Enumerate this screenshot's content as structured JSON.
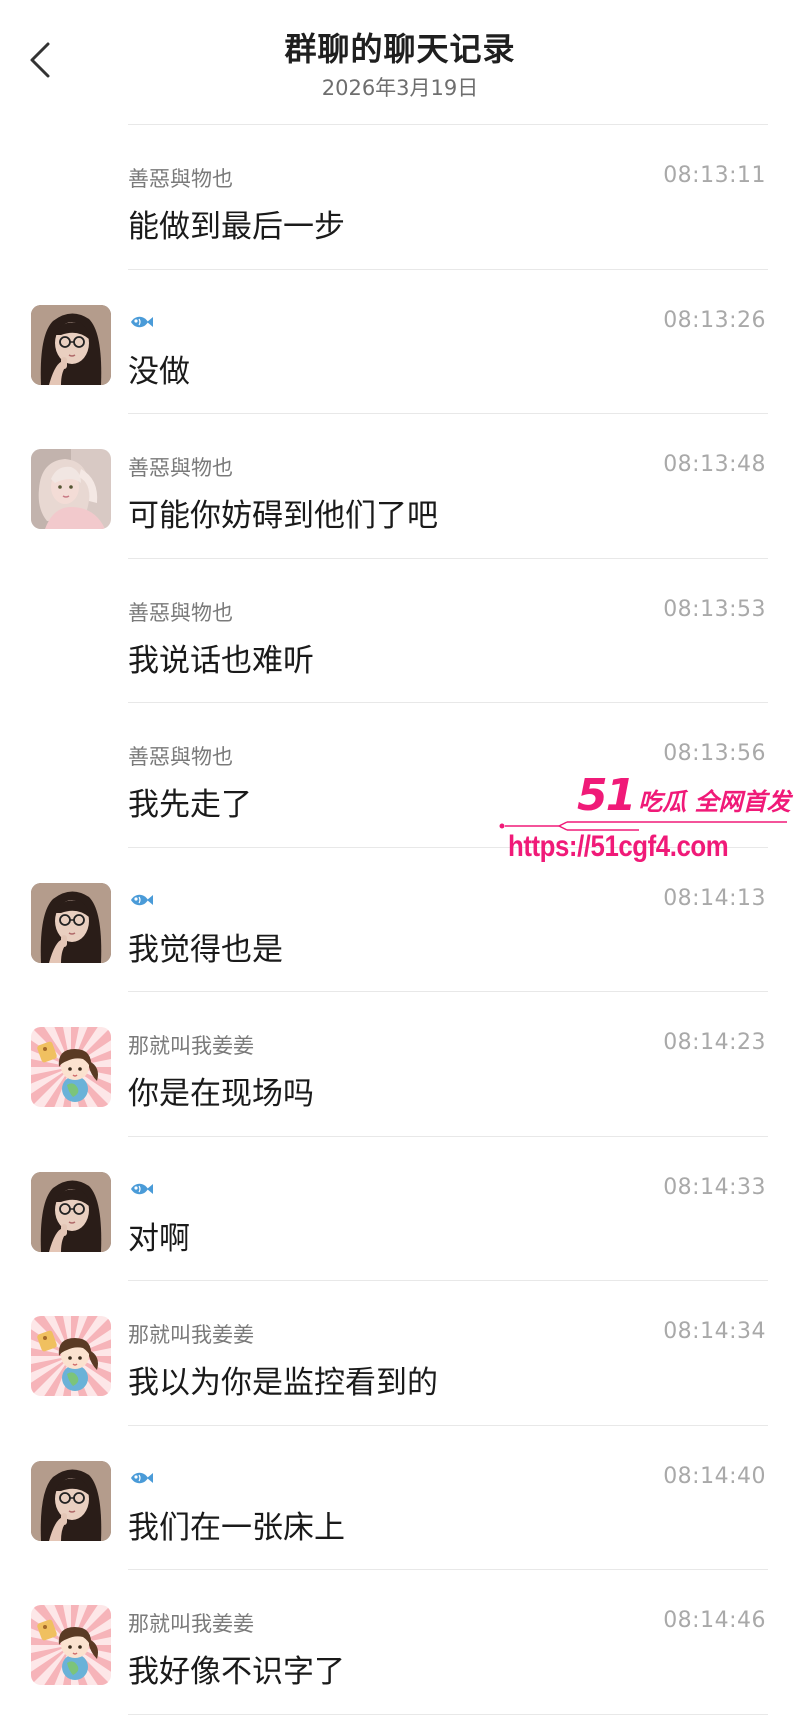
{
  "header": {
    "title": "群聊的聊天记录",
    "date": "2026年3月19日"
  },
  "colors": {
    "watermark": "#f01a78",
    "sender": "#7a7a7a",
    "time": "#a9a9a9",
    "fish": "#4a9bd8"
  },
  "messages": [
    {
      "sender": "善惡與物也",
      "avatar": "none",
      "time": "08:13:11",
      "text": "能做到最后一步"
    },
    {
      "sender": "",
      "sender_icon": "fish-icon",
      "avatar": "woman-glasses",
      "time": "08:13:26",
      "text": "没做"
    },
    {
      "sender": "善惡與物也",
      "avatar": "girl-pink",
      "time": "08:13:48",
      "text": "可能你妨碍到他们了吧"
    },
    {
      "sender": "善惡與物也",
      "avatar": "none",
      "time": "08:13:53",
      "text": "我说话也难听"
    },
    {
      "sender": "善惡與物也",
      "avatar": "none",
      "time": "08:13:56",
      "text": "我先走了"
    },
    {
      "sender": "",
      "sender_icon": "fish-icon",
      "avatar": "woman-glasses",
      "time": "08:14:13",
      "text": "我觉得也是"
    },
    {
      "sender": "那就叫我姜姜",
      "avatar": "cartoon-girl",
      "time": "08:14:23",
      "text": "你是在现场吗"
    },
    {
      "sender": "",
      "sender_icon": "fish-icon",
      "avatar": "woman-glasses",
      "time": "08:14:33",
      "text": "对啊"
    },
    {
      "sender": "那就叫我姜姜",
      "avatar": "cartoon-girl",
      "time": "08:14:34",
      "text": "我以为你是监控看到的"
    },
    {
      "sender": "",
      "sender_icon": "fish-icon",
      "avatar": "woman-glasses",
      "time": "08:14:40",
      "text": "我们在一张床上"
    },
    {
      "sender": "那就叫我姜姜",
      "avatar": "cartoon-girl",
      "time": "08:14:46",
      "text": "我好像不识字了"
    }
  ],
  "watermark": {
    "brand_num": "51",
    "brand_text": "吃瓜 全网首发",
    "url": "https://51cgf4.com"
  }
}
